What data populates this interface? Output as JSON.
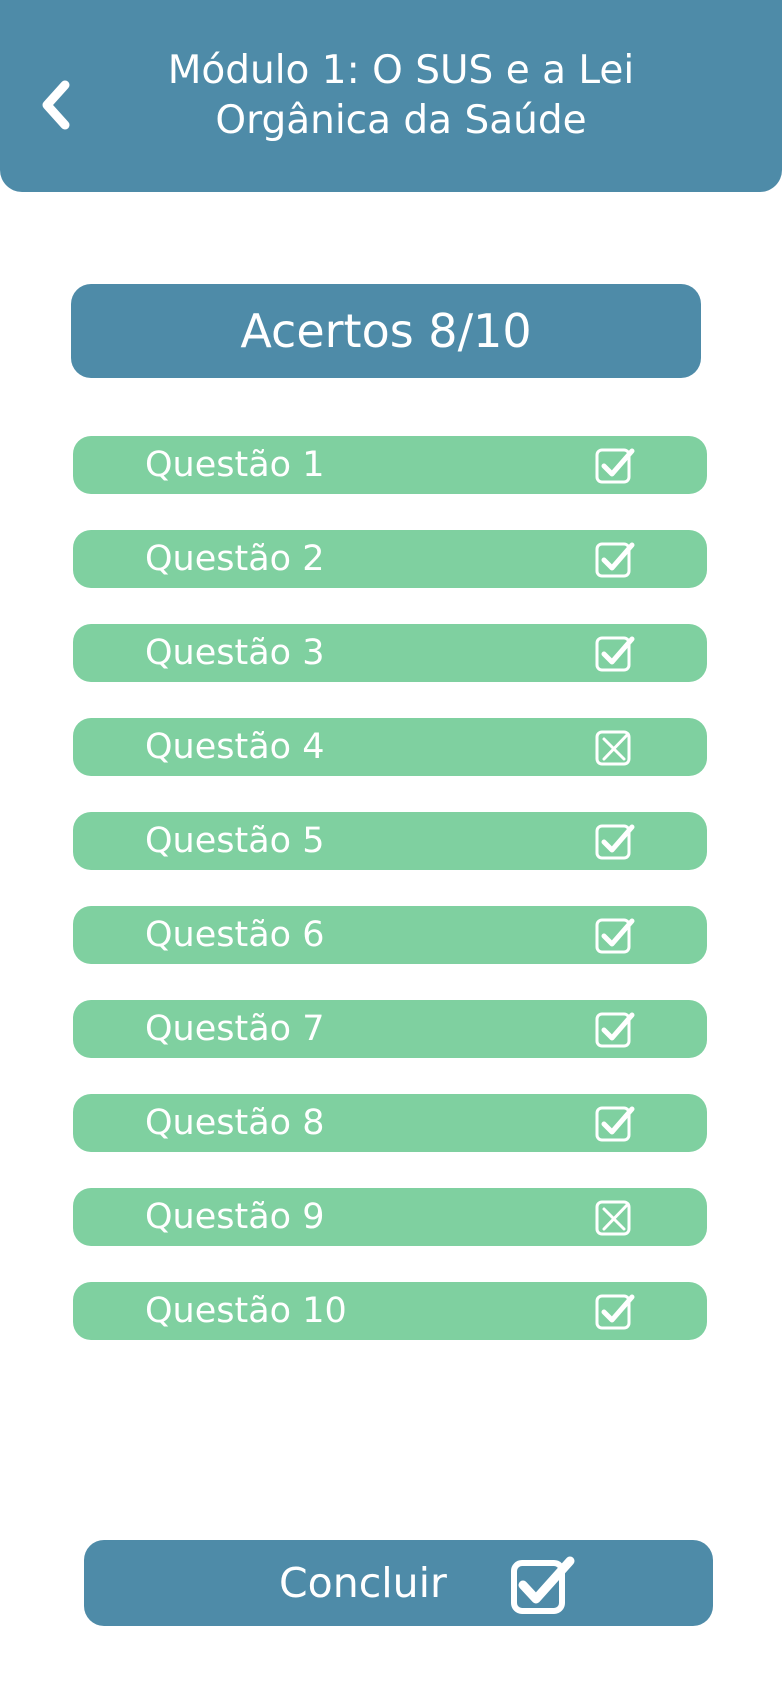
{
  "colors": {
    "primary": "#4e8ba8",
    "green": "#7fd0a0",
    "text": "#ffffff"
  },
  "header": {
    "back_icon": "chevron-left-icon",
    "title_line1": "Módulo 1: O SUS e a Lei",
    "title_line2": "Orgânica da Saúde"
  },
  "score": {
    "label": "Acertos 8/10"
  },
  "questions": [
    {
      "label": "Questão 1",
      "correct": true,
      "icon": "checkbox-checked-icon"
    },
    {
      "label": "Questão 2",
      "correct": true,
      "icon": "checkbox-checked-icon"
    },
    {
      "label": "Questão 3",
      "correct": true,
      "icon": "checkbox-checked-icon"
    },
    {
      "label": "Questão 4",
      "correct": false,
      "icon": "checkbox-crossed-icon"
    },
    {
      "label": "Questão 5",
      "correct": true,
      "icon": "checkbox-checked-icon"
    },
    {
      "label": "Questão 6",
      "correct": true,
      "icon": "checkbox-checked-icon"
    },
    {
      "label": "Questão 7",
      "correct": true,
      "icon": "checkbox-checked-icon"
    },
    {
      "label": "Questão 8",
      "correct": true,
      "icon": "checkbox-checked-icon"
    },
    {
      "label": "Questão 9",
      "correct": false,
      "icon": "checkbox-crossed-icon"
    },
    {
      "label": "Questão 10",
      "correct": true,
      "icon": "checkbox-checked-icon"
    }
  ],
  "footer": {
    "conclude_label": "Concluir",
    "conclude_icon": "checkbox-checked-icon"
  }
}
